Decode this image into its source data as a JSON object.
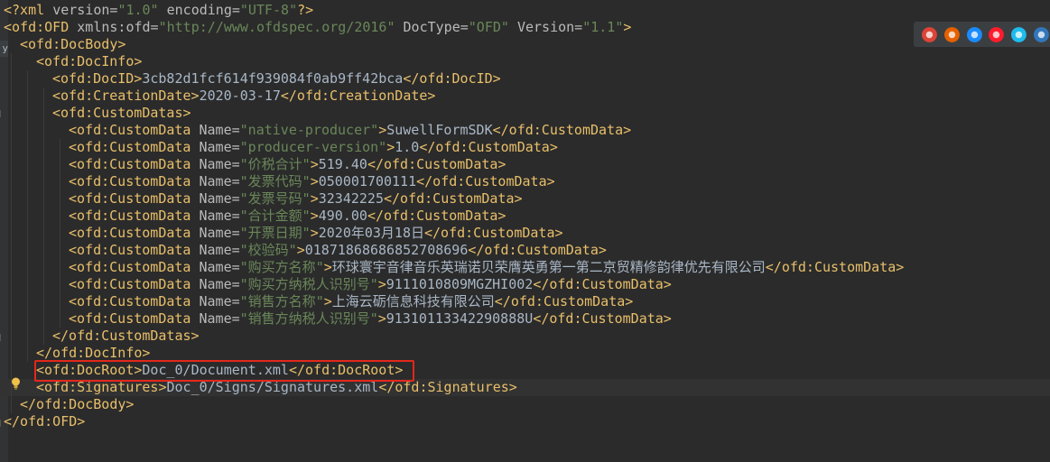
{
  "lines": [
    {
      "segments": [
        [
          "pi",
          "<?xml "
        ],
        [
          "a",
          "version="
        ],
        [
          "v",
          "\"1.0\""
        ],
        [
          "a",
          " encoding="
        ],
        [
          "v",
          "\"UTF-8\""
        ],
        [
          "pi",
          "?>"
        ]
      ],
      "indent": 0
    },
    {
      "segments": [
        [
          "t",
          "<ofd:OFD "
        ],
        [
          "a",
          "xmlns:ofd="
        ],
        [
          "v",
          "\"http://www.ofdspec.org/2016\""
        ],
        [
          "a",
          " DocType="
        ],
        [
          "v",
          "\"OFD\""
        ],
        [
          "a",
          " Version="
        ],
        [
          "v",
          "\"1.1\""
        ],
        [
          "t",
          ">"
        ]
      ],
      "indent": 0
    },
    {
      "segments": [
        [
          "t",
          "<ofd:DocBody>"
        ]
      ],
      "indent": 1
    },
    {
      "segments": [
        [
          "t",
          "<ofd:DocInfo>"
        ]
      ],
      "indent": 2
    },
    {
      "segments": [
        [
          "t",
          "<ofd:DocID>"
        ],
        [
          "x",
          "3cb82d1fcf614f939084f0ab9ff42bca"
        ],
        [
          "t",
          "</ofd:DocID>"
        ]
      ],
      "indent": 3
    },
    {
      "segments": [
        [
          "t",
          "<ofd:CreationDate>"
        ],
        [
          "x",
          "2020-03-17"
        ],
        [
          "t",
          "</ofd:CreationDate>"
        ]
      ],
      "indent": 3
    },
    {
      "segments": [
        [
          "t",
          "<ofd:CustomDatas>"
        ]
      ],
      "indent": 3
    },
    {
      "segments": [
        [
          "t",
          "<ofd:CustomData "
        ],
        [
          "a",
          "Name="
        ],
        [
          "v",
          "\"native-producer\""
        ],
        [
          "t",
          ">"
        ],
        [
          "x",
          "SuwellFormSDK"
        ],
        [
          "t",
          "</ofd:CustomData>"
        ]
      ],
      "indent": 4
    },
    {
      "segments": [
        [
          "t",
          "<ofd:CustomData "
        ],
        [
          "a",
          "Name="
        ],
        [
          "v",
          "\"producer-version\""
        ],
        [
          "t",
          ">"
        ],
        [
          "x",
          "1.0"
        ],
        [
          "t",
          "</ofd:CustomData>"
        ]
      ],
      "indent": 4
    },
    {
      "segments": [
        [
          "t",
          "<ofd:CustomData "
        ],
        [
          "a",
          "Name="
        ],
        [
          "v",
          "\"价税合计\""
        ],
        [
          "t",
          ">"
        ],
        [
          "x",
          "519.40"
        ],
        [
          "t",
          "</ofd:CustomData>"
        ]
      ],
      "indent": 4
    },
    {
      "segments": [
        [
          "t",
          "<ofd:CustomData "
        ],
        [
          "a",
          "Name="
        ],
        [
          "v",
          "\"发票代码\""
        ],
        [
          "t",
          ">"
        ],
        [
          "x",
          "050001700111"
        ],
        [
          "t",
          "</ofd:CustomData>"
        ]
      ],
      "indent": 4
    },
    {
      "segments": [
        [
          "t",
          "<ofd:CustomData "
        ],
        [
          "a",
          "Name="
        ],
        [
          "v",
          "\"发票号码\""
        ],
        [
          "t",
          ">"
        ],
        [
          "x",
          "32342225"
        ],
        [
          "t",
          "</ofd:CustomData>"
        ]
      ],
      "indent": 4
    },
    {
      "segments": [
        [
          "t",
          "<ofd:CustomData "
        ],
        [
          "a",
          "Name="
        ],
        [
          "v",
          "\"合计金额\""
        ],
        [
          "t",
          ">"
        ],
        [
          "x",
          "490.00"
        ],
        [
          "t",
          "</ofd:CustomData>"
        ]
      ],
      "indent": 4
    },
    {
      "segments": [
        [
          "t",
          "<ofd:CustomData "
        ],
        [
          "a",
          "Name="
        ],
        [
          "v",
          "\"开票日期\""
        ],
        [
          "t",
          ">"
        ],
        [
          "x",
          "2020年03月18日"
        ],
        [
          "t",
          "</ofd:CustomData>"
        ]
      ],
      "indent": 4
    },
    {
      "segments": [
        [
          "t",
          "<ofd:CustomData "
        ],
        [
          "a",
          "Name="
        ],
        [
          "v",
          "\"校验码\""
        ],
        [
          "t",
          ">"
        ],
        [
          "x",
          "01871868686852708696"
        ],
        [
          "t",
          "</ofd:CustomData>"
        ]
      ],
      "indent": 4
    },
    {
      "segments": [
        [
          "t",
          "<ofd:CustomData "
        ],
        [
          "a",
          "Name="
        ],
        [
          "v",
          "\"购买方名称\""
        ],
        [
          "t",
          ">"
        ],
        [
          "x",
          "环球寰宇音律音乐英瑞诺贝荣膺英勇第一第二京贸精修韵律优先有限公司"
        ],
        [
          "t",
          "</ofd:CustomData>"
        ]
      ],
      "indent": 4
    },
    {
      "segments": [
        [
          "t",
          "<ofd:CustomData "
        ],
        [
          "a",
          "Name="
        ],
        [
          "v",
          "\"购买方纳税人识别号\""
        ],
        [
          "t",
          ">"
        ],
        [
          "x",
          "9111010809MGZHI002"
        ],
        [
          "t",
          "</ofd:CustomData>"
        ]
      ],
      "indent": 4
    },
    {
      "segments": [
        [
          "t",
          "<ofd:CustomData "
        ],
        [
          "a",
          "Name="
        ],
        [
          "v",
          "\"销售方名称\""
        ],
        [
          "t",
          ">"
        ],
        [
          "x",
          "上海云砺信息科技有限公司"
        ],
        [
          "t",
          "</ofd:CustomData>"
        ]
      ],
      "indent": 4
    },
    {
      "segments": [
        [
          "t",
          "<ofd:CustomData "
        ],
        [
          "a",
          "Name="
        ],
        [
          "v",
          "\"销售方纳税人识别号\""
        ],
        [
          "t",
          ">"
        ],
        [
          "x",
          "91310113342290888U"
        ],
        [
          "t",
          "</ofd:CustomData>"
        ]
      ],
      "indent": 4
    },
    {
      "segments": [
        [
          "t",
          "</ofd:CustomDatas>"
        ]
      ],
      "indent": 3
    },
    {
      "segments": [
        [
          "t",
          "</ofd:DocInfo>"
        ]
      ],
      "indent": 2
    },
    {
      "segments": [
        [
          "t",
          "<ofd:DocRoot>"
        ],
        [
          "x",
          "Doc_0/Document.xml"
        ],
        [
          "t",
          "</ofd:DocRoot>"
        ]
      ],
      "indent": 2
    },
    {
      "segments": [
        [
          "t",
          "<ofd:Signatures>"
        ],
        [
          "x",
          "Doc_0/Signs/Signatures.xml"
        ],
        [
          "t",
          "</ofd:Signatures>"
        ]
      ],
      "indent": 2,
      "current": true
    },
    {
      "segments": [
        [
          "t",
          "</ofd:DocBody>"
        ]
      ],
      "indent": 1
    },
    {
      "segments": [
        [
          "t",
          "</ofd:OFD>"
        ]
      ],
      "indent": 0
    }
  ],
  "gutter_tab": "y",
  "browsers": [
    {
      "name": "chrome-icon",
      "color": "#db4437"
    },
    {
      "name": "firefox-icon",
      "color": "#e66000"
    },
    {
      "name": "safari-icon",
      "color": "#1a8cff"
    },
    {
      "name": "opera-icon",
      "color": "#ff1b2d"
    },
    {
      "name": "ie-icon",
      "color": "#1ebbee"
    },
    {
      "name": "edge-icon",
      "color": "#3277bc"
    }
  ],
  "colors": {
    "tag": "#e8bf6a",
    "attr": "#bababa",
    "value": "#6a8759",
    "text": "#a9b7c6",
    "highlight": "#e3271c"
  }
}
